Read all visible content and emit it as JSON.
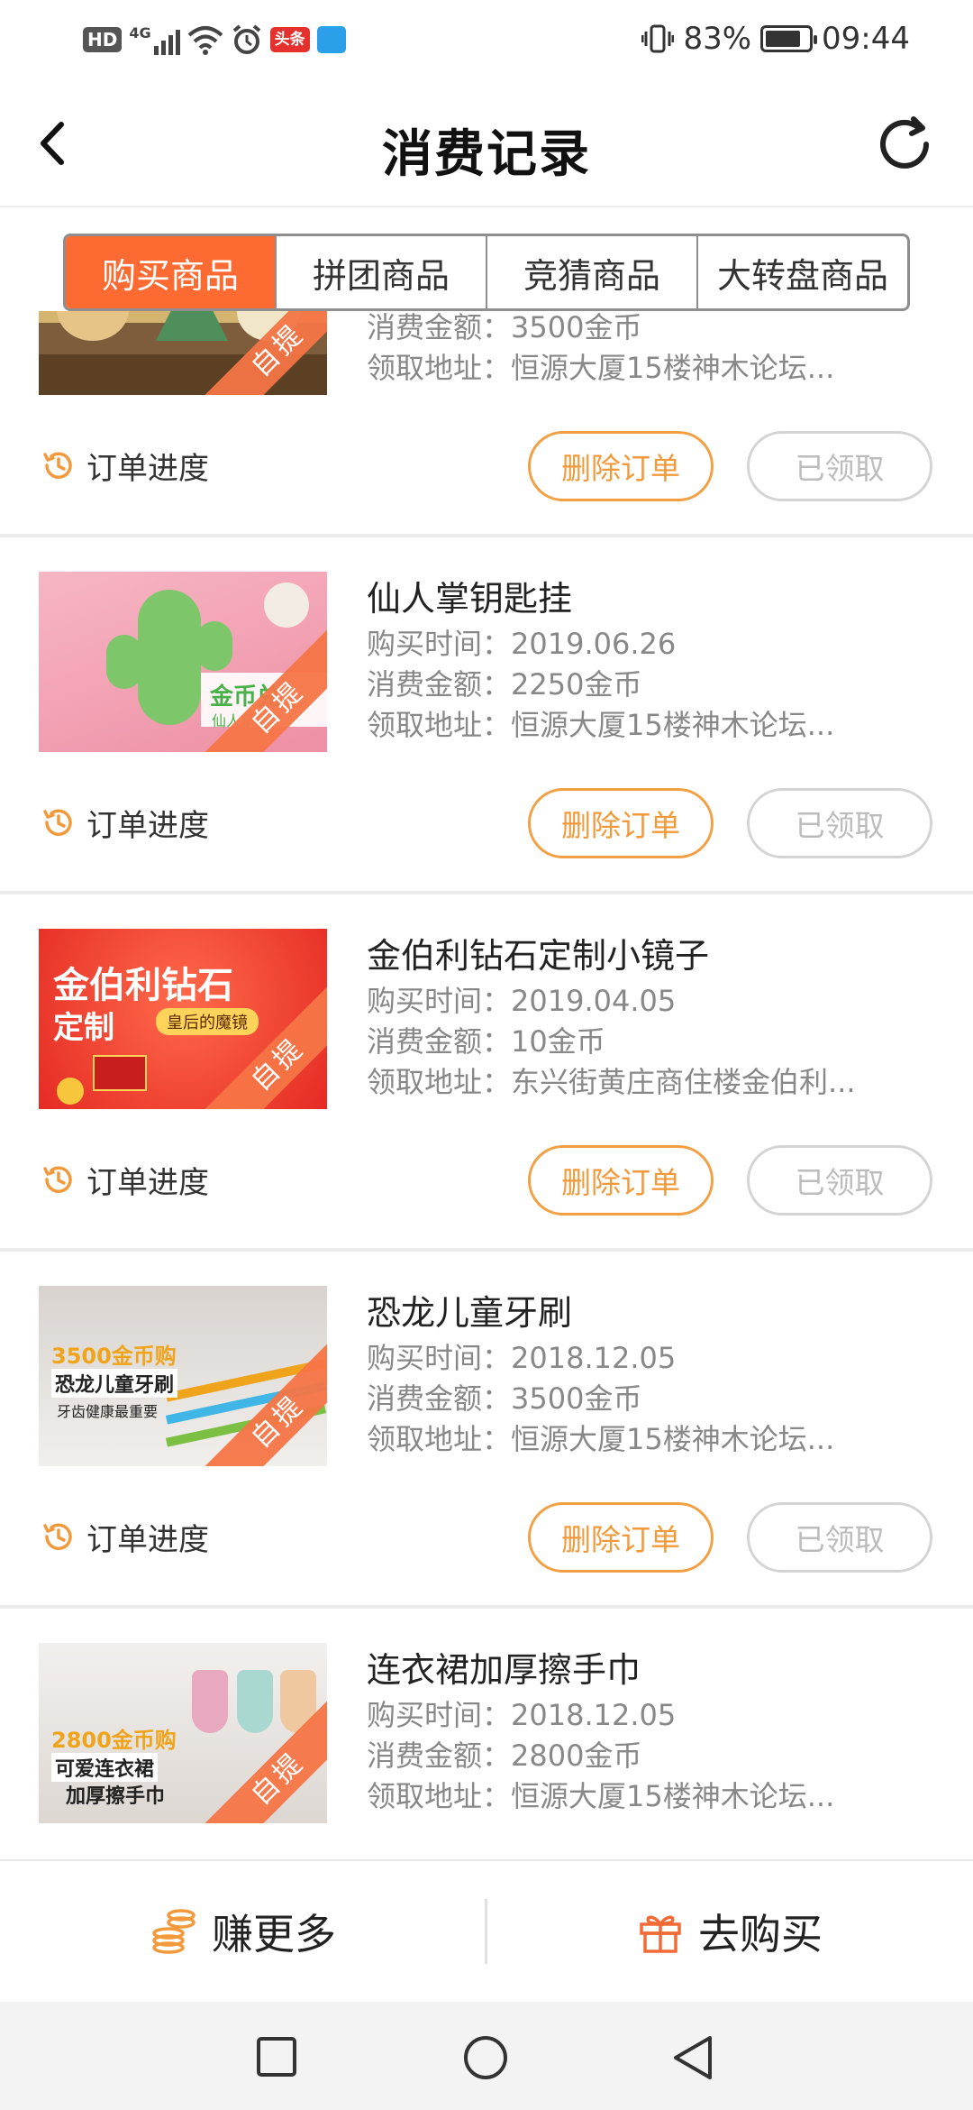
{
  "status_bar": {
    "left_indicators": [
      "HD",
      "4G",
      "头条"
    ],
    "battery_percent": "83%",
    "battery_level": 0.83,
    "time": "09:44"
  },
  "header": {
    "title": "消费记录",
    "back_icon": "chevron-left-icon",
    "refresh_icon": "refresh-icon"
  },
  "tabs": [
    {
      "label": "购买商品",
      "active": true
    },
    {
      "label": "拼团商品",
      "active": false
    },
    {
      "label": "竞猜商品",
      "active": false
    },
    {
      "label": "大转盘商品",
      "active": false
    }
  ],
  "labels": {
    "purchase_time": "购买时间：",
    "amount": "消费金额：",
    "address": "领取地址：",
    "progress": "订单进度",
    "delete": "删除订单",
    "claimed": "已领取",
    "pickup_badge": "自提"
  },
  "orders": [
    {
      "name": "",
      "time": "",
      "amount": "3500金币",
      "address": "恒源大厦15楼神木论坛..."
    },
    {
      "name": "仙人掌钥匙挂",
      "time": "2019.06.26",
      "amount": "2250金币",
      "address": "恒源大厦15楼神木论坛..."
    },
    {
      "name": "金伯利钻石定制小镜子",
      "time": "2019.04.05",
      "amount": "10金币",
      "address": "东兴街黄庄商住楼金伯利..."
    },
    {
      "name": "恐龙儿童牙刷",
      "time": "2018.12.05",
      "amount": "3500金币",
      "address": "恒源大厦15楼神木论坛..."
    },
    {
      "name": "连衣裙加厚擦手巾",
      "time": "2018.12.05",
      "amount": "2800金币",
      "address": "恒源大厦15楼神木论坛..."
    }
  ],
  "thumb_text": {
    "cactus_tag": "金币兑",
    "cactus_sub": "仙人掌",
    "mirror_line1": "金伯利钻石",
    "mirror_line2": "定制",
    "mirror_tag": "皇后的魔镜",
    "toothbrush_price": "3500金币购",
    "toothbrush_name": "恐龙儿童牙刷",
    "toothbrush_sub": "牙齿健康最重要",
    "towel_price": "2800金币购",
    "towel_line1": "可爱连衣裙",
    "towel_line2": "加厚擦手巾"
  },
  "bottom_bar": {
    "earn_more": "赚更多",
    "go_buy": "去购买"
  },
  "colors": {
    "accent": "#fd6a32",
    "delete_border": "#f2a043",
    "claimed_border": "#d4d4d4"
  }
}
